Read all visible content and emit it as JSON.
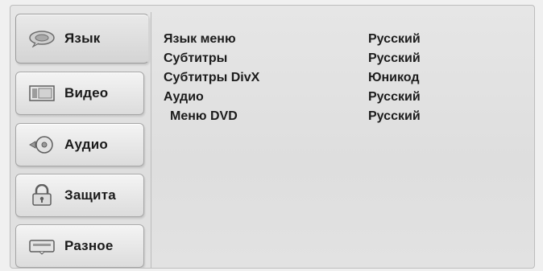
{
  "sidebar": {
    "tabs": [
      {
        "label": "Язык",
        "icon": "speech-bubble-icon",
        "active": true
      },
      {
        "label": "Видео",
        "icon": "film-icon",
        "active": false
      },
      {
        "label": "Аудио",
        "icon": "speaker-disc-icon",
        "active": false
      },
      {
        "label": "Защита",
        "icon": "lock-icon",
        "active": false
      },
      {
        "label": "Разное",
        "icon": "keyboard-icon",
        "active": false
      }
    ]
  },
  "settings": [
    {
      "name": "Язык меню",
      "value": "Русский"
    },
    {
      "name": "Субтитры",
      "value": "Русский"
    },
    {
      "name": "Субтитры DivX",
      "value": "Юникод"
    },
    {
      "name": "Аудио",
      "value": "Русский"
    },
    {
      "name": "Меню DVD",
      "value": "Русский"
    }
  ]
}
